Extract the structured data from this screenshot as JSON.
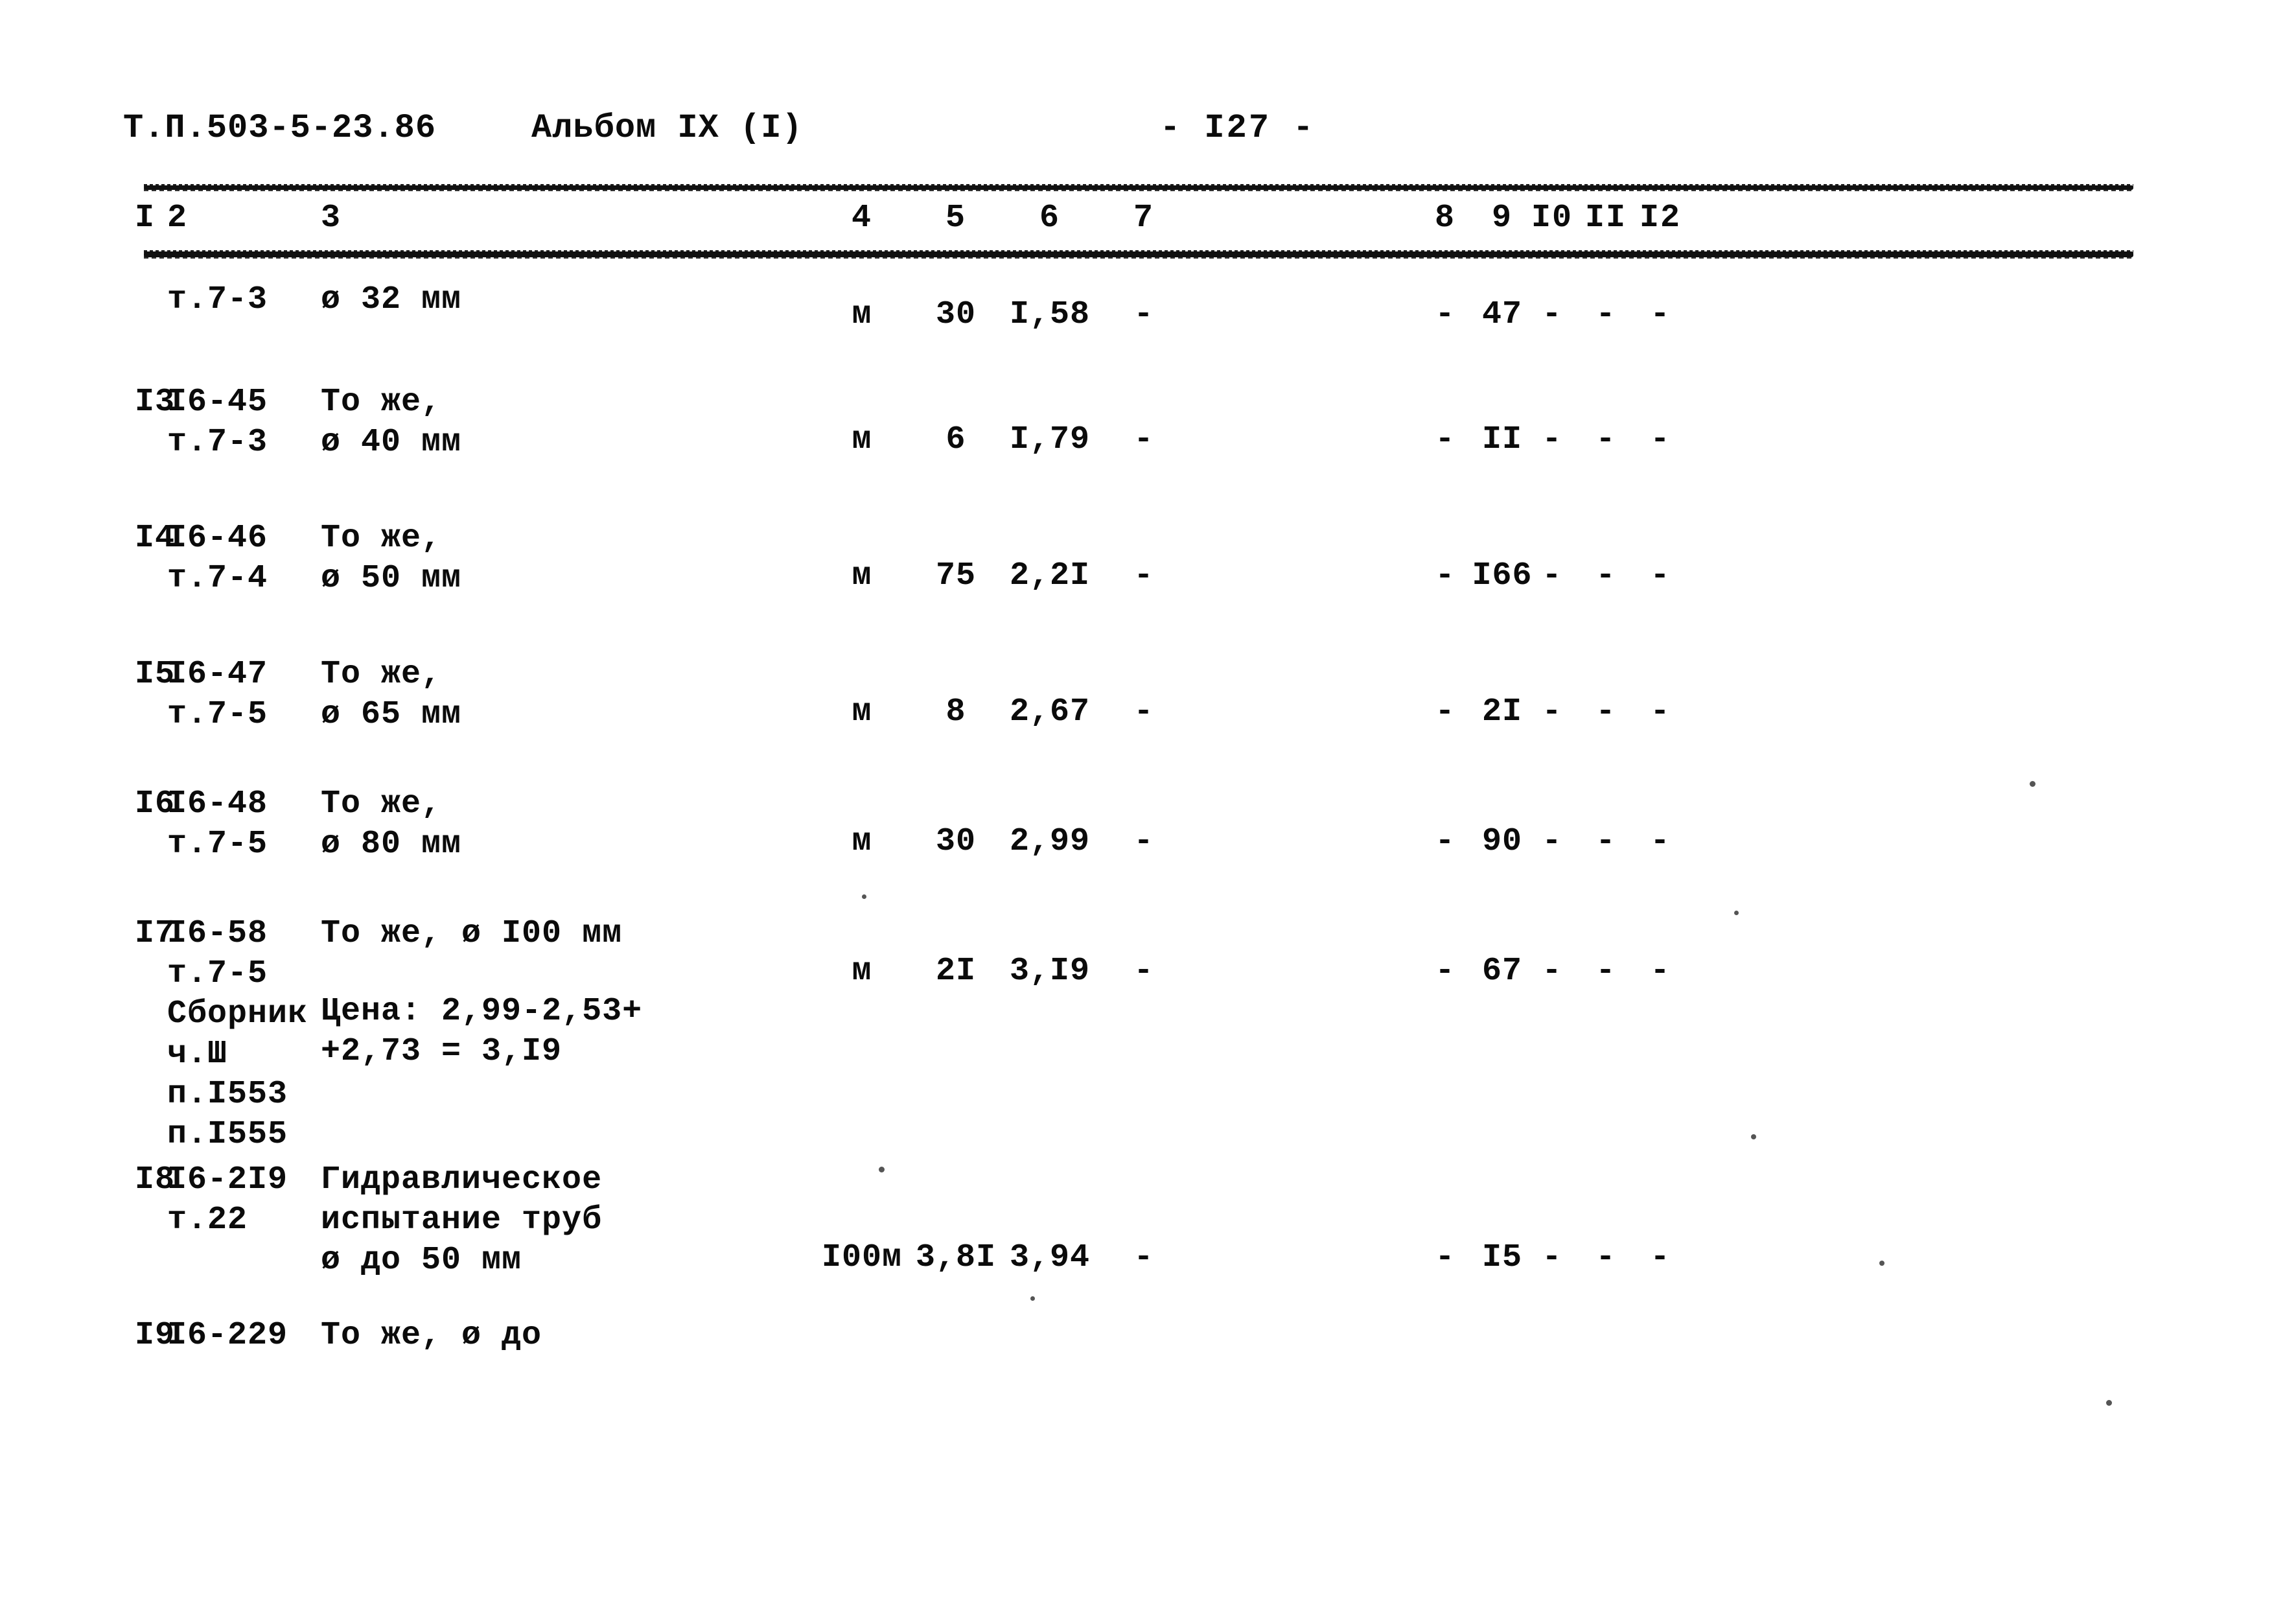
{
  "header": {
    "doc_code": "Т.П.503-5-23.86",
    "album": "Альбом IX (I)",
    "page_number": "- I27 -"
  },
  "table": {
    "column_numbers": [
      "I",
      "2",
      "3",
      "4",
      "5",
      "6",
      "7",
      "8",
      "9",
      "I0",
      "II",
      "I2"
    ],
    "rows": [
      {
        "num": "",
        "code": "т.7-3",
        "desc": "ø 32 мм",
        "unit": "м",
        "qty": "30",
        "price": "I,58",
        "c7": "-",
        "c8": "-",
        "total": "47",
        "c10": "-",
        "c11": "-",
        "c12": "-"
      },
      {
        "num": "I3",
        "code": "I6-45\nт.7-3",
        "desc": "То же,\nø 40 мм",
        "unit": "м",
        "qty": "6",
        "price": "I,79",
        "c7": "-",
        "c8": "-",
        "total": "II",
        "c10": "-",
        "c11": "-",
        "c12": "-"
      },
      {
        "num": "I4",
        "code": "I6-46\nт.7-4",
        "desc": "То же,\nø 50 мм",
        "unit": "м",
        "qty": "75",
        "price": "2,2I",
        "c7": "-",
        "c8": "-",
        "total": "I66",
        "c10": "-",
        "c11": "-",
        "c12": "-"
      },
      {
        "num": "I5",
        "code": "I6-47\nт.7-5",
        "desc": "То же,\nø 65 мм",
        "unit": "м",
        "qty": "8",
        "price": "2,67",
        "c7": "-",
        "c8": "-",
        "total": "2I",
        "c10": "-",
        "c11": "-",
        "c12": "-"
      },
      {
        "num": "I6",
        "code": "I6-48\nт.7-5",
        "desc": "То же,\nø 80 мм",
        "unit": "м",
        "qty": "30",
        "price": "2,99",
        "c7": "-",
        "c8": "-",
        "total": "90",
        "c10": "-",
        "c11": "-",
        "c12": "-"
      },
      {
        "num": "I7",
        "code": "I6-58\nт.7-5\nСборник\nч.Ш\nп.I553\nп.I555",
        "desc": "То же, ø I00 мм",
        "desc2": "Цена: 2,99-2,53+\n+2,73 = 3,I9",
        "unit": "м",
        "qty": "2I",
        "price": "3,I9",
        "c7": "-",
        "c8": "-",
        "total": "67",
        "c10": "-",
        "c11": "-",
        "c12": "-"
      },
      {
        "num": "I8",
        "code": "I6-2I9\nт.22",
        "desc": "Гидравлическое\nиспытание труб\nø до 50 мм",
        "unit": "I00м",
        "qty": "3,8I",
        "price": "3,94",
        "c7": "-",
        "c8": "-",
        "total": "I5",
        "c10": "-",
        "c11": "-",
        "c12": "-"
      },
      {
        "num": "I9",
        "code": "I6-229",
        "desc": "То же, ø до",
        "unit": "",
        "qty": "",
        "price": "",
        "c7": "",
        "c8": "",
        "total": "",
        "c10": "",
        "c11": "",
        "c12": ""
      }
    ]
  }
}
